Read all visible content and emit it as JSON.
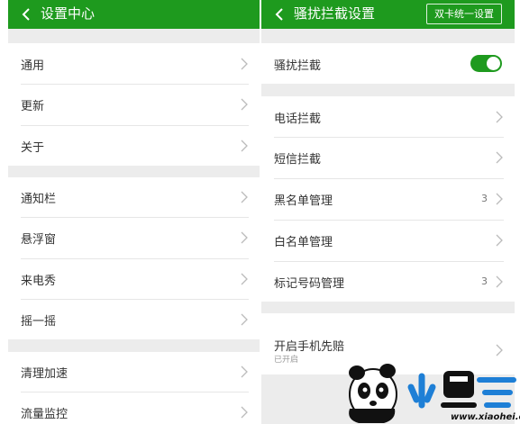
{
  "left": {
    "header": {
      "title": "设置中心"
    },
    "groups": [
      {
        "items": [
          {
            "label": "通用"
          },
          {
            "label": "更新"
          },
          {
            "label": "关于"
          }
        ]
      },
      {
        "items": [
          {
            "label": "通知栏"
          },
          {
            "label": "悬浮窗"
          },
          {
            "label": "来电秀"
          },
          {
            "label": "摇一摇"
          }
        ]
      },
      {
        "items": [
          {
            "label": "清理加速"
          },
          {
            "label": "流量监控"
          }
        ]
      }
    ]
  },
  "right": {
    "header": {
      "title": "骚扰拦截设置",
      "action_label": "双卡统一设置"
    },
    "toggle_row": {
      "label": "骚扰拦截",
      "enabled": true
    },
    "items": [
      {
        "label": "电话拦截",
        "count": ""
      },
      {
        "label": "短信拦截",
        "count": ""
      },
      {
        "label": "黑名单管理",
        "count": "3"
      },
      {
        "label": "白名单管理",
        "count": ""
      },
      {
        "label": "标记号码管理",
        "count": "3"
      }
    ],
    "compensation_row": {
      "label": "开启手机先赔",
      "status": "已开启"
    }
  },
  "watermark": {
    "text": "小黑游戏",
    "url": "www.xiaohei.com"
  },
  "colors": {
    "accent": "#1e9a1e",
    "background": "#ececec",
    "text": "#333333",
    "secondary_text": "#999999"
  }
}
